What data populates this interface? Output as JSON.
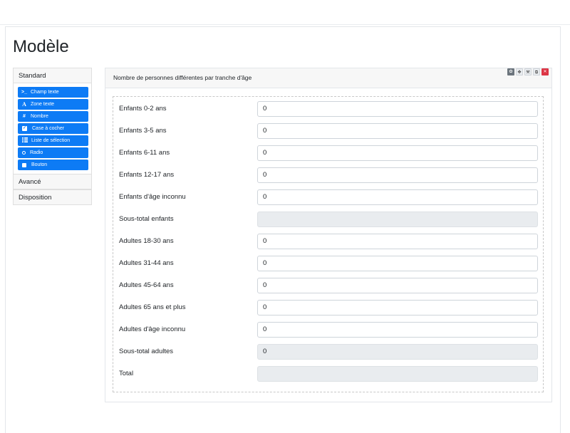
{
  "page": {
    "title": "Modèle"
  },
  "sidebar": {
    "sections": [
      {
        "label": "Standard"
      },
      {
        "label": "Avancé"
      },
      {
        "label": "Disposition"
      }
    ],
    "tools": [
      {
        "label": "Champ texte",
        "icon": ">_"
      },
      {
        "label": "Zone texte",
        "icon": "A"
      },
      {
        "label": "Nombre",
        "icon": "#"
      },
      {
        "label": "Case à cocher",
        "icon": "checkbox-icon"
      },
      {
        "label": "Liste de sélection",
        "icon": "list-icon"
      },
      {
        "label": "Radio",
        "icon": "radio-icon"
      },
      {
        "label": "Bouton",
        "icon": "stop-icon"
      }
    ]
  },
  "panel": {
    "title": "Nombre de personnes différentes par tranche d'âge",
    "toolbar": [
      "gear-icon",
      "move-icon",
      "wrench-icon",
      "copy-icon",
      "close-icon"
    ],
    "rows": [
      {
        "label": "Enfants 0-2 ans",
        "value": "0",
        "readonly": false
      },
      {
        "label": "Enfants 3-5 ans",
        "value": "0",
        "readonly": false
      },
      {
        "label": "Enfants 6-11 ans",
        "value": "0",
        "readonly": false
      },
      {
        "label": "Enfants 12-17 ans",
        "value": "0",
        "readonly": false
      },
      {
        "label": "Enfants d'âge inconnu",
        "value": "0",
        "readonly": false
      },
      {
        "label": "Sous-total enfants",
        "value": "",
        "readonly": true
      },
      {
        "label": "Adultes 18-30 ans",
        "value": "0",
        "readonly": false
      },
      {
        "label": "Adultes 31-44 ans",
        "value": "0",
        "readonly": false
      },
      {
        "label": "Adultes 45-64 ans",
        "value": "0",
        "readonly": false
      },
      {
        "label": "Adultes 65 ans et plus",
        "value": "0",
        "readonly": false
      },
      {
        "label": "Adultes d'âge inconnu",
        "value": "0",
        "readonly": false
      },
      {
        "label": "Sous-total adultes",
        "value": "0",
        "readonly": true
      },
      {
        "label": "Total",
        "value": "",
        "readonly": true
      }
    ]
  },
  "colors": {
    "primary": "#0d7bf5",
    "danger": "#dc3545",
    "readonly_bg": "#e9ecef"
  }
}
